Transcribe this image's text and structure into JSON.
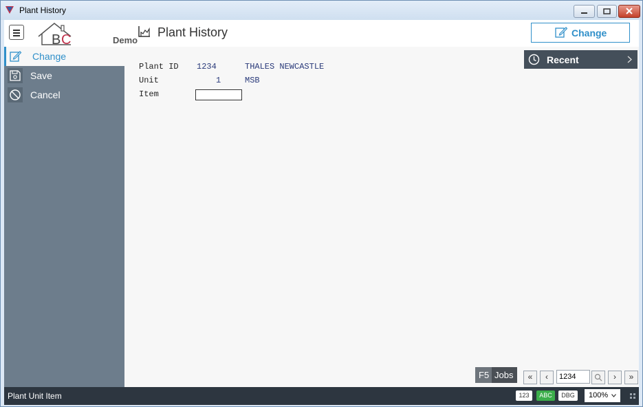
{
  "window": {
    "title": "Plant History"
  },
  "header": {
    "logo_letters": "BC",
    "logo_text": "Demo",
    "page_title": "Plant History",
    "change_button": "Change"
  },
  "sidebar": {
    "items": [
      {
        "label": "Change",
        "icon": "pencil-icon",
        "active": true
      },
      {
        "label": "Save",
        "icon": "floppy-icon",
        "active": false
      },
      {
        "label": "Cancel",
        "icon": "cancel-icon",
        "active": false
      }
    ]
  },
  "form": {
    "plant_id": {
      "label": "Plant ID",
      "value": "1234",
      "description": "THALES NEWCASTLE"
    },
    "unit": {
      "label": "Unit",
      "value": "1",
      "description": "MSB"
    },
    "item": {
      "label": "Item",
      "value": ""
    }
  },
  "recent": {
    "label": "Recent"
  },
  "jobs": {
    "key": "F5",
    "label": "Jobs"
  },
  "pager": {
    "value": "1234"
  },
  "status": {
    "text": "Plant Unit Item",
    "badges": [
      "123",
      "ABC",
      "DBG"
    ],
    "zoom": "100%"
  },
  "colors": {
    "accent": "#2f8fc9",
    "sidebar": "#6d7d8c",
    "statusbar": "#2d3640",
    "abc_badge": "#3cae4b"
  }
}
